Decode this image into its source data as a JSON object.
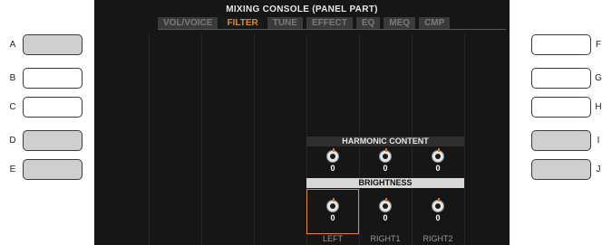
{
  "screen": {
    "title": "MIXING CONSOLE (PANEL PART)",
    "tabs": [
      {
        "label": "VOL/VOICE",
        "active": false
      },
      {
        "label": "FILTER",
        "active": true
      },
      {
        "label": "TUNE",
        "active": false
      },
      {
        "label": "EFFECT",
        "active": false
      },
      {
        "label": "EQ",
        "active": false
      },
      {
        "label": "MEQ",
        "active": false
      },
      {
        "label": "CMP",
        "active": false
      }
    ],
    "harmonic_content": {
      "label": "HARMONIC CONTENT",
      "values": [
        "0",
        "0",
        "0"
      ]
    },
    "brightness": {
      "label": "BRIGHTNESS",
      "values": [
        "0",
        "0",
        "0"
      ]
    },
    "parts": [
      "LEFT",
      "RIGHT1",
      "RIGHT2"
    ],
    "selected_part": "LEFT"
  },
  "left_buttons": [
    {
      "letter": "A",
      "lit": true
    },
    {
      "letter": "B",
      "lit": false
    },
    {
      "letter": "C",
      "lit": false
    },
    {
      "letter": "D",
      "lit": true
    },
    {
      "letter": "E",
      "lit": true
    }
  ],
  "right_buttons": [
    {
      "letter": "F",
      "lit": false
    },
    {
      "letter": "G",
      "lit": false
    },
    {
      "letter": "H",
      "lit": false
    },
    {
      "letter": "I",
      "lit": true
    },
    {
      "letter": "J",
      "lit": true
    }
  ],
  "colors": {
    "accent": "#e08a2a",
    "screen_bg": "#161616",
    "button_lit": "#cfcfcf"
  }
}
